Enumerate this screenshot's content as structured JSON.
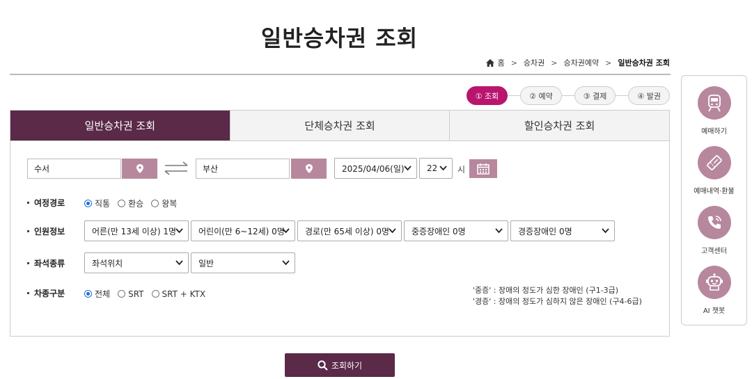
{
  "page": {
    "title": "일반승차권 조회"
  },
  "breadcrumb": {
    "items": [
      "홈",
      "승차권",
      "승차권예약",
      "일반승차권 조회"
    ]
  },
  "steps": [
    {
      "label": "① 조회",
      "active": true
    },
    {
      "label": "② 예약",
      "active": false
    },
    {
      "label": "③ 결제",
      "active": false
    },
    {
      "label": "④ 발권",
      "active": false
    }
  ],
  "tabs": [
    {
      "label": "일반승차권 조회",
      "active": true
    },
    {
      "label": "단체승차권 조회",
      "active": false
    },
    {
      "label": "할인승차권 조회",
      "active": false
    }
  ],
  "search": {
    "departure": "수서",
    "arrival": "부산",
    "date": "2025/04/06(일)",
    "hour": "22",
    "hour_unit": "시"
  },
  "trip_route": {
    "label": "여정경로",
    "options": [
      {
        "label": "직통",
        "checked": true
      },
      {
        "label": "환승",
        "checked": false
      },
      {
        "label": "왕복",
        "checked": false
      }
    ]
  },
  "passengers": {
    "label": "인원정보",
    "selects": [
      "어른(만 13세 이상) 1명",
      "어린이(만 6~12세) 0명",
      "경로(만 65세 이상) 0명",
      "중증장애인 0명",
      "경증장애인 0명"
    ]
  },
  "seat": {
    "label": "좌석종류",
    "selects": [
      "좌석위치",
      "일반"
    ]
  },
  "train_type": {
    "label": "차종구분",
    "options": [
      {
        "label": "전체",
        "checked": true
      },
      {
        "label": "SRT",
        "checked": false
      },
      {
        "label": "SRT + KTX",
        "checked": false
      }
    ]
  },
  "notes": [
    "'중증' : 장애의 정도가 심한 장애인 (구1-3급)",
    "'경증' : 장애의 정도가 심하지 않은 장애인 (구4-6급)"
  ],
  "submit": {
    "label": "조회하기"
  },
  "quick_menu": [
    {
      "label": "예매하기",
      "icon": "train-icon"
    },
    {
      "label": "예매내역·환불",
      "icon": "ticket-icon"
    },
    {
      "label": "고객센터",
      "icon": "phone-icon"
    },
    {
      "label": "AI 챗봇",
      "icon": "chatbot-icon"
    }
  ],
  "colors": {
    "primary": "#5a2a48",
    "accent": "#b8156f",
    "button_muted": "#b7889d"
  }
}
